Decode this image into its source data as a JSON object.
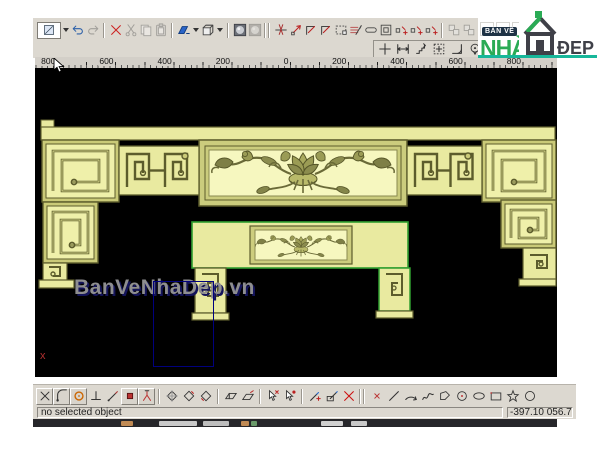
{
  "logo": {
    "badge": "BẢN VẼ",
    "brand_green": "NHÀ",
    "brand_dark": "ĐẸP"
  },
  "watermark": {
    "text": "BanVeNhaDep.vn"
  },
  "statusbar": {
    "message": "no selected object",
    "coords": "-397.10 056.7"
  },
  "canvas": {
    "origin_label": "x",
    "background": "#000000",
    "wood_light": "#f6f7bf",
    "wood_mid": "#e9eaa0",
    "wood_dark": "#5c5c2c",
    "selection_green": "#2f9e2f",
    "selection_navy": "#00007e"
  },
  "ruler": {
    "labels": [
      "800",
      "600",
      "400",
      "200",
      "0",
      "200",
      "400",
      "600",
      "800"
    ]
  },
  "toolbar_top": {
    "items": [
      {
        "type": "combo",
        "name": "view-preset-combobox"
      },
      {
        "icon": "undo",
        "name": "undo-button"
      },
      {
        "icon": "redo",
        "name": "redo-button",
        "disabled": true
      },
      {
        "type": "sep"
      },
      {
        "icon": "delete",
        "name": "delete-button"
      },
      {
        "icon": "cut",
        "name": "cut-button",
        "disabled": true
      },
      {
        "icon": "copy",
        "name": "copy-button",
        "disabled": true
      },
      {
        "icon": "paste",
        "name": "paste-button",
        "disabled": true
      },
      {
        "type": "sep"
      },
      {
        "icon": "fill",
        "name": "fill-tool-button"
      },
      {
        "type": "dd",
        "name": "fill-tool-dropdown"
      },
      {
        "icon": "box3d",
        "name": "view-3d-button"
      },
      {
        "type": "dd",
        "name": "view-3d-dropdown"
      },
      {
        "type": "sep"
      },
      {
        "icon": "sphere",
        "name": "render-shaded-button"
      },
      {
        "icon": "sphere",
        "name": "render-flat-button",
        "disabled": true
      },
      {
        "type": "sep2"
      },
      {
        "icon": "trim",
        "name": "trim-tool-button"
      },
      {
        "icon": "nodearrow",
        "name": "node-edit-button"
      },
      {
        "icon": "corner",
        "name": "corner-tool-button"
      },
      {
        "icon": "corner",
        "name": "chamfer-tool-button"
      },
      {
        "icon": "dashrect",
        "name": "bounding-box-button"
      },
      {
        "icon": "hatchpen",
        "name": "hatch-tool-button"
      },
      {
        "icon": "capsule",
        "name": "slot-tool-button"
      },
      {
        "icon": "sqinsq",
        "name": "offset-tool-button"
      },
      {
        "icon": "nodeadd",
        "name": "node-add-button"
      },
      {
        "icon": "nodeadd",
        "name": "node-insert-button"
      },
      {
        "icon": "nodeadd",
        "name": "node-delete-button"
      },
      {
        "type": "sep"
      },
      {
        "icon": "group",
        "name": "group-button",
        "disabled": true
      },
      {
        "icon": "group",
        "name": "ungroup-button",
        "disabled": true
      }
    ]
  },
  "toolbar_nav": {
    "items": [
      {
        "icon": "cross",
        "name": "pan-center-button"
      },
      {
        "icon": "measure",
        "name": "measure-button"
      },
      {
        "icon": "stairs",
        "name": "zoom-previous-button"
      },
      {
        "icon": "zoombox",
        "name": "zoom-window-button"
      },
      {
        "icon": "angle",
        "name": "zoom-scale-button"
      },
      {
        "icon": "balloon",
        "name": "zoom-object-button"
      }
    ]
  },
  "toolbar_bottom": {
    "items": [
      {
        "icon": "xshape",
        "name": "snap-intersection-button",
        "framed": true
      },
      {
        "icon": "arccorner",
        "name": "snap-tangent-button",
        "framed": true
      },
      {
        "icon": "redcircle",
        "name": "snap-center-button",
        "framed": true
      },
      {
        "icon": "perp",
        "name": "snap-perpendicular-button"
      },
      {
        "icon": "pickpen",
        "name": "snap-nearest-button"
      },
      {
        "icon": "dotsq",
        "name": "snap-grid-button",
        "framed": true
      },
      {
        "icon": "person",
        "name": "snap-node-button",
        "framed": true
      },
      {
        "type": "sep"
      },
      {
        "icon": "diamond",
        "name": "view-iso-button"
      },
      {
        "icon": "diamond2",
        "name": "view-top-button"
      },
      {
        "icon": "diamond3",
        "name": "view-front-button"
      },
      {
        "type": "sep"
      },
      {
        "icon": "plane",
        "name": "work-plane-button"
      },
      {
        "icon": "plane2",
        "name": "work-plane-edit-button"
      },
      {
        "type": "sep"
      },
      {
        "icon": "cursor1",
        "name": "select-tool-button"
      },
      {
        "icon": "cursor2",
        "name": "erase-tool-button"
      },
      {
        "type": "sep"
      },
      {
        "icon": "pencheck",
        "name": "edit-node-pen-button"
      },
      {
        "icon": "penrect",
        "name": "edit-curve-pen-button"
      },
      {
        "icon": "bigredx",
        "name": "delete-selected-button"
      },
      {
        "type": "sep2"
      },
      {
        "icon": "smallx",
        "name": "point-tool-button"
      },
      {
        "icon": "linetool",
        "name": "line-tool-button"
      },
      {
        "icon": "arctool",
        "name": "arc-tool-button"
      },
      {
        "icon": "polyline",
        "name": "polyline-tool-button"
      },
      {
        "icon": "polygon",
        "name": "polygon-tool-button"
      },
      {
        "icon": "circledot",
        "name": "circle-center-tool-button"
      },
      {
        "icon": "ellipse",
        "name": "ellipse-tool-button"
      },
      {
        "icon": "recttool",
        "name": "rectangle-tool-button"
      },
      {
        "icon": "star",
        "name": "star-tool-button"
      },
      {
        "icon": "circle",
        "name": "circle-tool-button"
      }
    ]
  }
}
